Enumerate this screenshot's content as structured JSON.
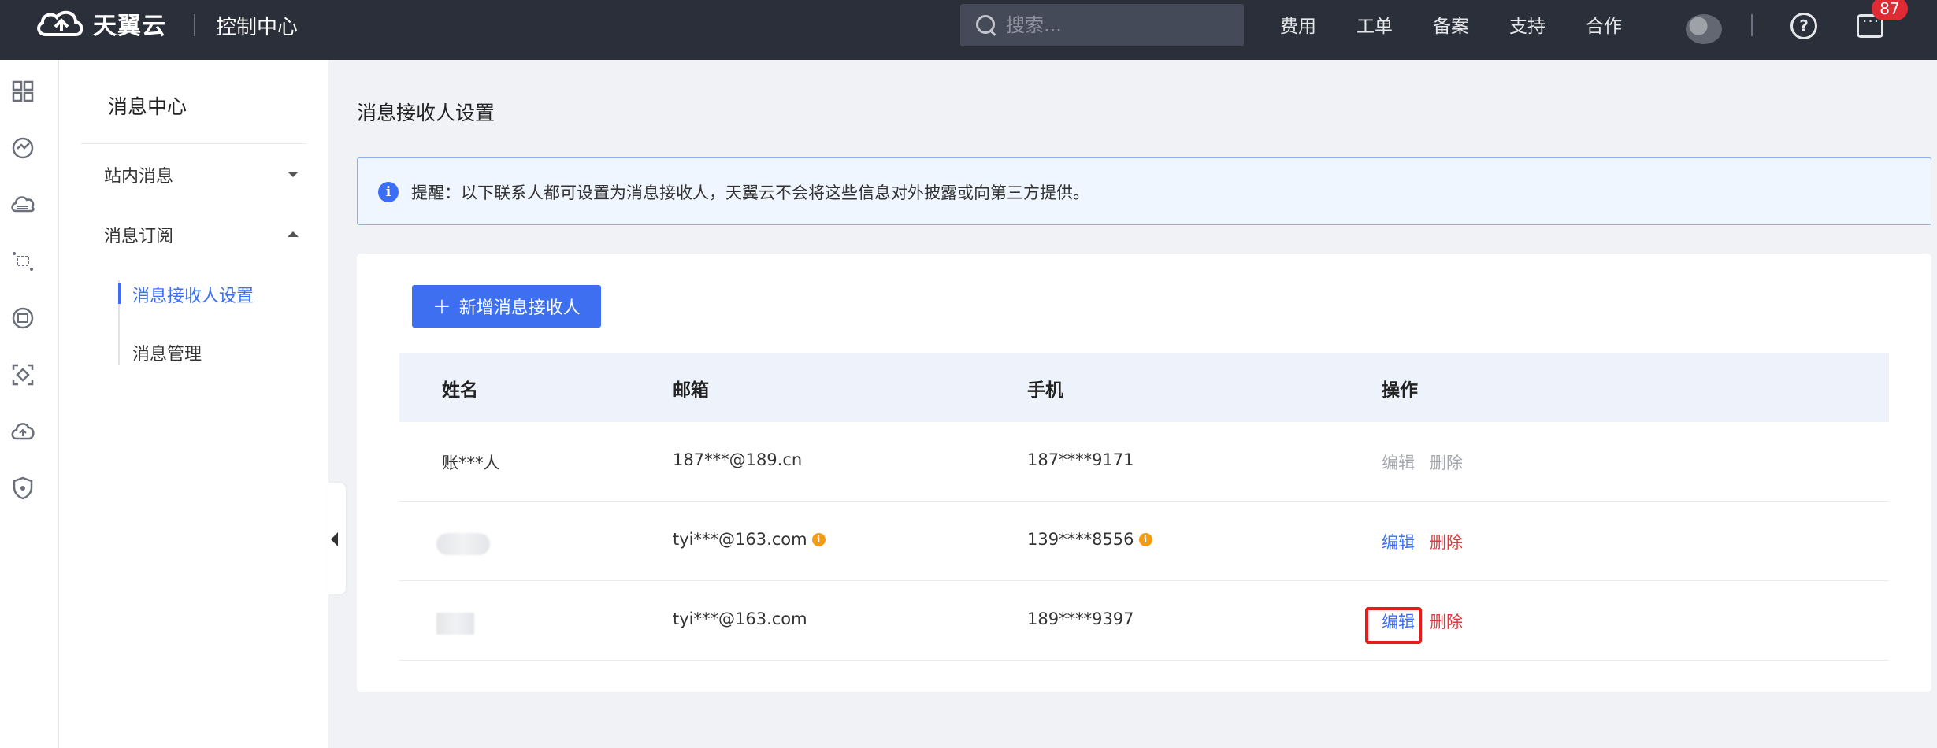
{
  "topbar": {
    "brand": "天翼云",
    "console": "控制中心",
    "search_placeholder": "搜索...",
    "nav": [
      "费用",
      "工单",
      "备案",
      "支持",
      "合作"
    ],
    "message_count": "87"
  },
  "sidebar": {
    "title": "消息中心",
    "items": [
      {
        "label": "站内消息",
        "expanded": false
      },
      {
        "label": "消息订阅",
        "expanded": true
      }
    ],
    "subitems": [
      "消息接收人设置",
      "消息管理"
    ],
    "active_subitem": "消息接收人设置"
  },
  "main": {
    "title": "消息接收人设置",
    "notice": "提醒：以下联系人都可设置为消息接收人，天翼云不会将这些信息对外披露或向第三方提供。",
    "add_button": "新增消息接收人",
    "table": {
      "headers": [
        "姓名",
        "邮箱",
        "手机",
        "操作"
      ],
      "rows": [
        {
          "name": "账***人",
          "email": "187***@189.cn",
          "phone": "187****9171",
          "edit": "编辑",
          "delete": "删除",
          "actions_enabled": false
        },
        {
          "name": "",
          "email": "tyi***@163.com",
          "phone": "139****8556",
          "edit": "编辑",
          "delete": "删除",
          "actions_enabled": true
        },
        {
          "name": "",
          "email": "tyi***@163.com",
          "phone": "189****9397",
          "edit": "编辑",
          "delete": "删除",
          "actions_enabled": true
        }
      ]
    }
  },
  "colors": {
    "topbar": "#2b2f3a",
    "accent": "#3b6ef5",
    "danger": "#e0383e",
    "highlight": "#e81b1b"
  }
}
